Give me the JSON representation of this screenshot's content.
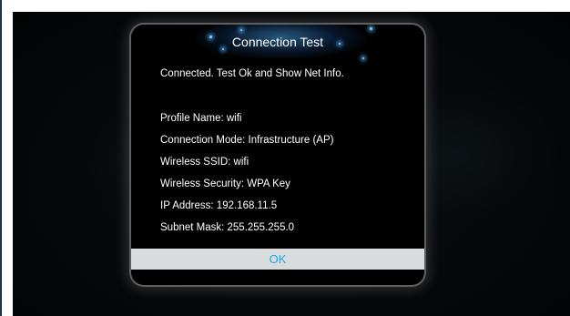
{
  "dialog": {
    "title": "Connection Test",
    "status": "Connected. Test Ok and Show Net Info.",
    "info": [
      "Profile Name: wifi",
      "Connection Mode: Infrastructure (AP)",
      "Wireless SSID: wifi",
      "Wireless Security: WPA Key",
      "IP Address: 192.168.11.5",
      "Subnet Mask: 255.255.255.0"
    ],
    "ok_label": "OK"
  },
  "colors": {
    "ok_text": "#1fa9e8",
    "ok_background": "#d8dcdc",
    "dialog_background": "#000000",
    "accent_glow": "#46a0e6"
  }
}
